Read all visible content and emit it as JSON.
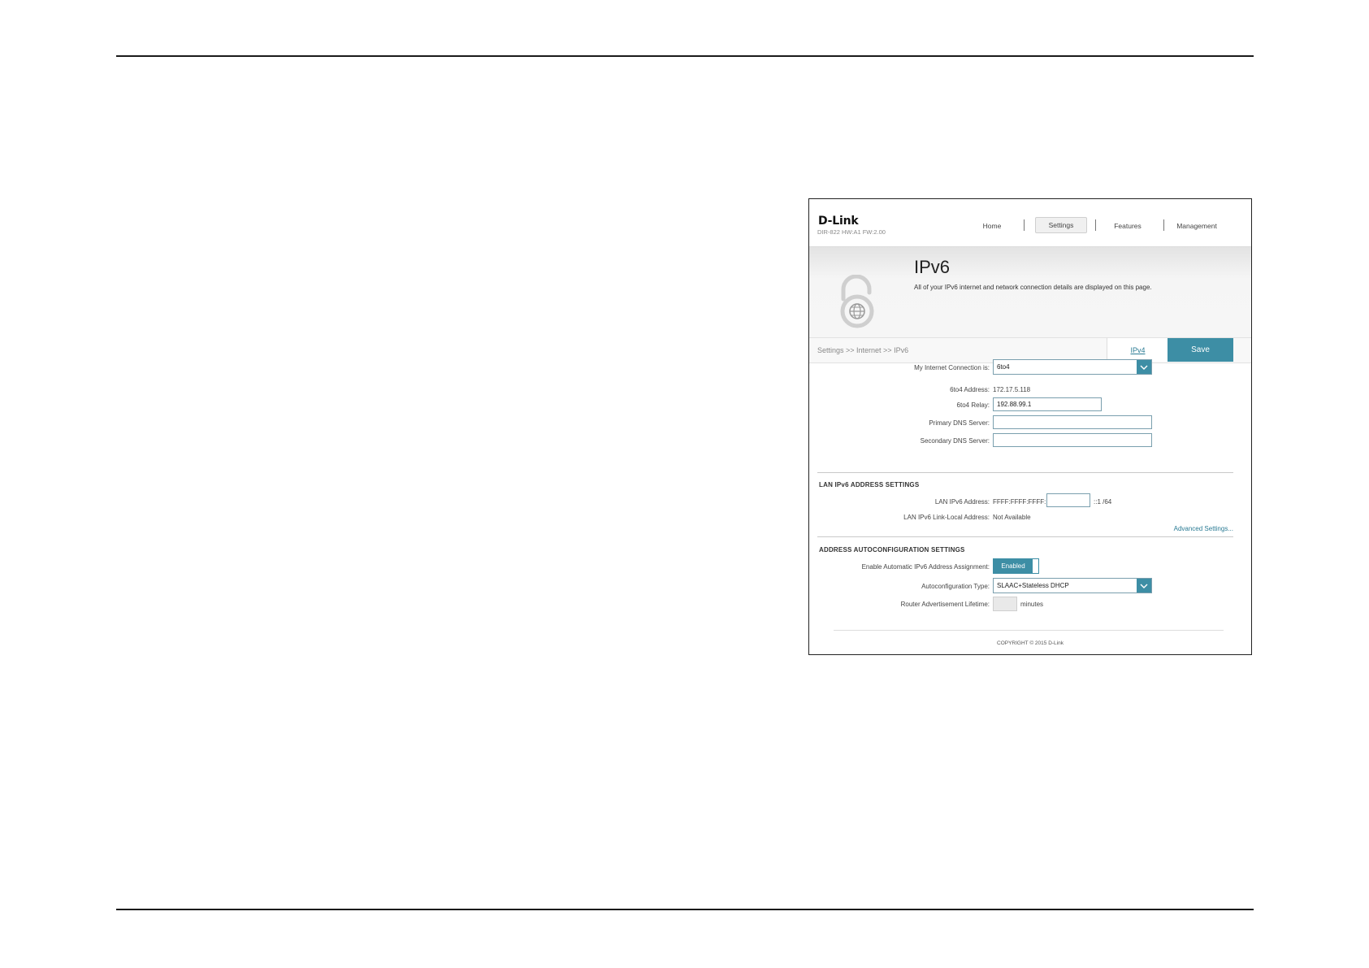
{
  "header": {
    "logo": "D-Link",
    "model": "DIR-822 HW:A1 FW:2.00",
    "nav": [
      {
        "label": "Home"
      },
      {
        "label": "Settings"
      },
      {
        "label": "Features"
      },
      {
        "label": "Management"
      }
    ]
  },
  "banner": {
    "title": "IPv6",
    "description": "All of your IPv6 internet and network connection details are displayed on this page."
  },
  "breadcrumb": "Settings >> Internet >> IPv6",
  "buttons": {
    "ipv4": "IPv4",
    "save": "Save"
  },
  "connection": {
    "label": "My Internet Connection is:",
    "value": "6to4"
  },
  "fields": {
    "sixto4_address_label": "6to4 Address:",
    "sixto4_address_value": "172.17.5.118",
    "sixto4_relay_label": "6to4 Relay:",
    "sixto4_relay_value": "192.88.99.1",
    "primary_dns_label": "Primary DNS Server:",
    "primary_dns_value": "",
    "secondary_dns_label": "Secondary DNS Server:",
    "secondary_dns_value": ""
  },
  "lan": {
    "section_title": "LAN IPv6 ADDRESS SETTINGS",
    "address_label": "LAN IPv6 Address:",
    "address_prefix": "FFFF:FFFF:FFFF:",
    "address_suffix": "::1 /64",
    "link_local_label": "LAN IPv6 Link-Local Address:",
    "link_local_value": "Not Available",
    "advanced_link": "Advanced Settings..."
  },
  "autoconfig": {
    "section_title": "ADDRESS AUTOCONFIGURATION SETTINGS",
    "enable_label": "Enable Automatic IPv6 Address Assignment:",
    "enable_value": "Enabled",
    "type_label": "Autoconfiguration Type:",
    "type_value": "SLAAC+Stateless DHCP",
    "lifetime_label": "Router Advertisement Lifetime:",
    "lifetime_unit": "minutes"
  },
  "footer": {
    "copyright": "COPYRIGHT © 2015 D-Link"
  },
  "colors": {
    "accent": "#3d8ea5",
    "link": "#2a7b94"
  }
}
